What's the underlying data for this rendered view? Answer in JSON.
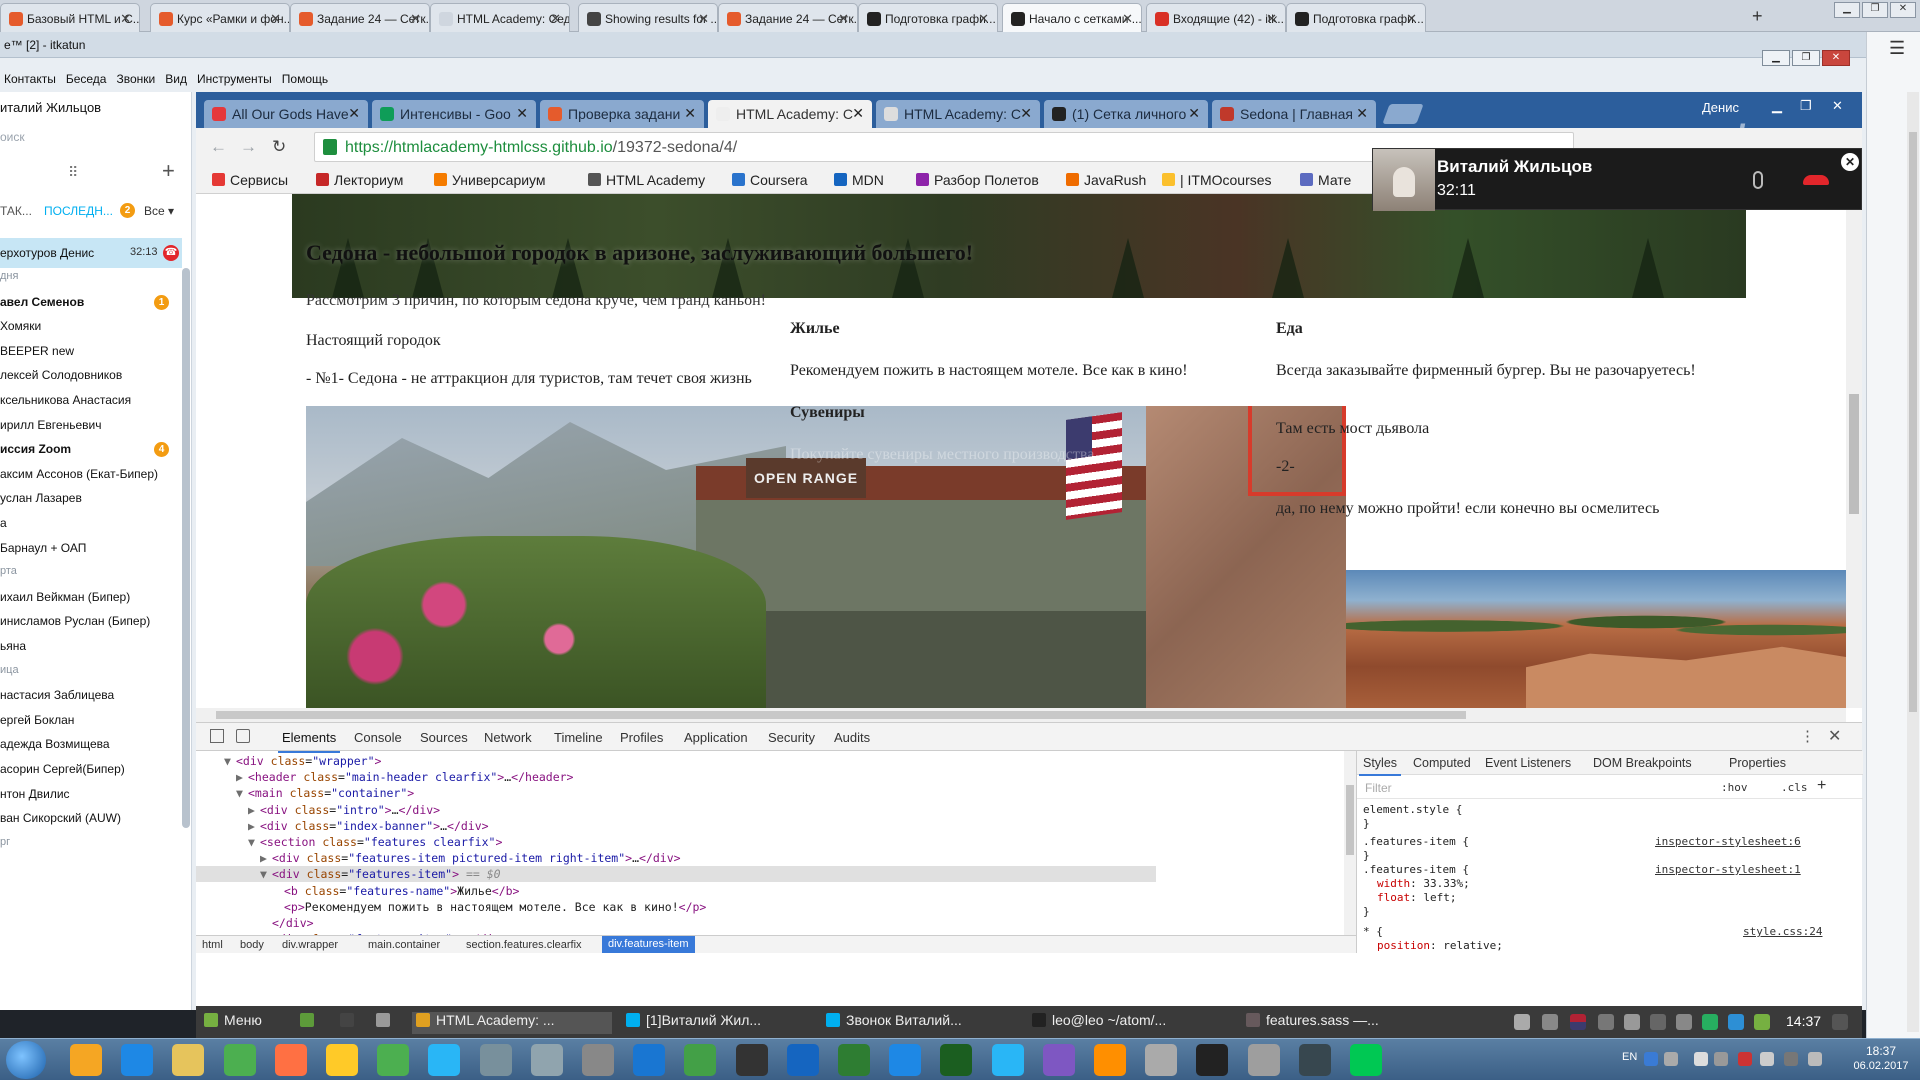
{
  "outer_tabs": [
    {
      "label": "Базовый HTML и С...",
      "color": "#e55b2c",
      "active": false
    },
    {
      "label": "Курс «Рамки и фон...",
      "color": "#e55b2c",
      "active": false
    },
    {
      "label": "Задание 24 — Сетк...",
      "color": "#e55b2c",
      "active": false
    },
    {
      "label": "HTML Academy: Седона",
      "color": "#cfd6df",
      "active": false
    },
    {
      "label": "Showing results for ...",
      "color": "#444444",
      "active": false
    },
    {
      "label": "Задание 24 — Сетк...",
      "color": "#e55b2c",
      "active": false
    },
    {
      "label": "Подготовка графи...",
      "color": "#222222",
      "active": false
    },
    {
      "label": "Начало с сетками ...",
      "color": "#222222",
      "active": true
    },
    {
      "label": "Входящие (42) - itk...",
      "color": "#d93025",
      "active": false
    },
    {
      "label": "Подготовка графи...",
      "color": "#222222",
      "active": false
    }
  ],
  "skype": {
    "window_title": "e™ [2] - itkatun",
    "menu": [
      "Контакты",
      "Беседа",
      "Звонки",
      "Вид",
      "Инструменты",
      "Помощь"
    ],
    "profile_name": "италий Жильцов",
    "search_placeholder": "оиск",
    "filter_contacts": "ТАК...",
    "filter_recent": "ПОСЛЕДН...",
    "filter_recent_badge": "2",
    "filter_all": "Все",
    "active_chat": {
      "name": "ерхотуров Денис",
      "time": "32:13"
    },
    "contacts": [
      {
        "name": "дня",
        "type": "section"
      },
      {
        "name": "авел Семенов",
        "type": "bold",
        "badge": "1"
      },
      {
        "name": "Хомяки",
        "type": "normal"
      },
      {
        "name": "BEEPER new",
        "type": "normal"
      },
      {
        "name": "лексей Солодовников",
        "type": "normal"
      },
      {
        "name": "ксельникова Анастасия",
        "type": "normal"
      },
      {
        "name": "ирилл Евгеньевич",
        "type": "normal"
      },
      {
        "name": "иссия Zoom",
        "type": "bold",
        "badge": "4"
      },
      {
        "name": "аксим Ассонов (Екат-Бипер)",
        "type": "normal"
      },
      {
        "name": "услан Лазарев",
        "type": "normal"
      },
      {
        "name": "a",
        "type": "normal"
      },
      {
        "name": "Барнаул + ОАП",
        "type": "normal"
      },
      {
        "name": "рта",
        "type": "section"
      },
      {
        "name": "ихаил Вейкман (Бипер)",
        "type": "normal"
      },
      {
        "name": "инисламов Руслан (Бипер)",
        "type": "normal"
      },
      {
        "name": "ьяна",
        "type": "normal"
      },
      {
        "name": "ица",
        "type": "section"
      },
      {
        "name": "настасия Заблицева",
        "type": "normal"
      },
      {
        "name": "ергей Боклан",
        "type": "normal"
      },
      {
        "name": "адежда Возмищева",
        "type": "normal"
      },
      {
        "name": "асорин Сергей(Бипер)",
        "type": "normal"
      },
      {
        "name": "нтон Двилис",
        "type": "normal"
      },
      {
        "name": "ван Сикорский (AUW)",
        "type": "normal"
      },
      {
        "name": "рг",
        "type": "section"
      }
    ]
  },
  "inner_browser": {
    "tabs": [
      {
        "label": "All Our Gods Have",
        "color": "#e5383b",
        "active": false
      },
      {
        "label": "Интенсивы - Goo",
        "color": "#0f9d58",
        "active": false
      },
      {
        "label": "Проверка задани",
        "color": "#e55b2c",
        "active": false
      },
      {
        "label": "HTML Academy: С",
        "color": "#eeeeee",
        "active": true
      },
      {
        "label": "HTML Academy: С",
        "color": "#dddddd",
        "active": false
      },
      {
        "label": "(1) Сетка личного",
        "color": "#222222",
        "active": false
      },
      {
        "label": "Sedona | Главная",
        "color": "#c0392b",
        "active": false
      }
    ],
    "user": "Денис",
    "url_host": "https://htmlacademy-htmlcss.github.io",
    "url_path": "/19372-sedona/4/",
    "bookmarks": [
      {
        "label": "Сервисы",
        "color": "#e53935"
      },
      {
        "label": "Лекториум",
        "color": "#c62828"
      },
      {
        "label": "Универсариум",
        "color": "#f57c00"
      },
      {
        "label": "HTML Academy",
        "color": "#555555"
      },
      {
        "label": "Coursera",
        "color": "#2a73cc"
      },
      {
        "label": "MDN",
        "color": "#1565c0"
      },
      {
        "label": "Разбор Полетов",
        "color": "#8e24aa"
      },
      {
        "label": "JavaRush",
        "color": "#ef6c00"
      },
      {
        "label": "| ITMOcourses",
        "color": "#fbc02d"
      },
      {
        "label": "Мате",
        "color": "#5c6bc0"
      }
    ]
  },
  "webpage": {
    "banner_title": "Седона - небольшой городок в аризоне, заслуживающий большего!",
    "intro": "Рассмотрим 3 причин, по которым седона круче, чем гранд каньон!",
    "col1_title": "Настоящий городок",
    "col1_text": "- №1- Седона - не аттракцион для туристов, там течет своя жизнь",
    "col2_title": "Жилье",
    "col2_text": "Рекомендуем пожить в настоящем мотеле. Все как в кино!",
    "col2_title2": "Сувениры",
    "col2_text2": "Покупайте сувениры местного производства",
    "col3_title": "Еда",
    "col3_text": "Всегда заказывайте фирменный бургер. Вы не разочаруетесь!",
    "col3_text2": "Там есть мост дьявола",
    "col3_text3": "-2-",
    "col3_text4": "да, по нему можно пройти! если конечно вы осмелитесь",
    "sign_text": "OPEN RANGE"
  },
  "call": {
    "name": "Виталий Жильцов",
    "time": "32:11"
  },
  "devtools": {
    "tabs": [
      "Elements",
      "Console",
      "Sources",
      "Network",
      "Timeline",
      "Profiles",
      "Application",
      "Security",
      "Audits"
    ],
    "styles_tabs": [
      "Styles",
      "Computed",
      "Event Listeners",
      "DOM Breakpoints",
      "Properties"
    ],
    "filter_placeholder": "Filter",
    "hov": ":hov",
    "cls": ".cls",
    "dom": [
      {
        "indent": 0,
        "arrow": "▼",
        "html": "<span class=\"tag\">&lt;div</span> <span class=\"attr\">class</span>=<span class=\"val\">\"wrapper\"</span><span class=\"tag\">&gt;</span>"
      },
      {
        "indent": 1,
        "arrow": "▶",
        "html": "<span class=\"tag\">&lt;header</span> <span class=\"attr\">class</span>=<span class=\"val\">\"main-header clearfix\"</span><span class=\"tag\">&gt;</span>…<span class=\"tag\">&lt;/header&gt;</span>"
      },
      {
        "indent": 1,
        "arrow": "▼",
        "html": "<span class=\"tag\">&lt;main</span> <span class=\"attr\">class</span>=<span class=\"val\">\"container\"</span><span class=\"tag\">&gt;</span>"
      },
      {
        "indent": 2,
        "arrow": "▶",
        "html": "<span class=\"tag\">&lt;div</span> <span class=\"attr\">class</span>=<span class=\"val\">\"intro\"</span><span class=\"tag\">&gt;</span>…<span class=\"tag\">&lt;/div&gt;</span>"
      },
      {
        "indent": 2,
        "arrow": "▶",
        "html": "<span class=\"tag\">&lt;div</span> <span class=\"attr\">class</span>=<span class=\"val\">\"index-banner\"</span><span class=\"tag\">&gt;</span>…<span class=\"tag\">&lt;/div&gt;</span>"
      },
      {
        "indent": 2,
        "arrow": "▼",
        "html": "<span class=\"tag\">&lt;section</span> <span class=\"attr\">class</span>=<span class=\"val\">\"features clearfix\"</span><span class=\"tag\">&gt;</span>"
      },
      {
        "indent": 3,
        "arrow": "▶",
        "html": "<span class=\"tag\">&lt;div</span> <span class=\"attr\">class</span>=<span class=\"val\">\"features-item pictured-item right-item\"</span><span class=\"tag\">&gt;</span>…<span class=\"tag\">&lt;/div&gt;</span>"
      },
      {
        "indent": 3,
        "arrow": "▼",
        "html": "<span class=\"tag\">&lt;div</span> <span class=\"attr\">class</span>=<span class=\"val\">\"features-item\"</span><span class=\"tag\">&gt;</span> <span class=\"eq0\">== $0</span>",
        "selected": true
      },
      {
        "indent": 4,
        "arrow": "",
        "html": "<span class=\"tag\">&lt;b</span> <span class=\"attr\">class</span>=<span class=\"val\">\"features-name\"</span><span class=\"tag\">&gt;</span><span class=\"txt\">Жилье</span><span class=\"tag\">&lt;/b&gt;</span>"
      },
      {
        "indent": 4,
        "arrow": "",
        "html": "<span class=\"tag\">&lt;p&gt;</span><span class=\"txt\">Рекомендуем пожить в настоящем мотеле. Все как в кино!</span><span class=\"tag\">&lt;/p&gt;</span>"
      },
      {
        "indent": 3,
        "arrow": "",
        "html": "<span class=\"tag\">&lt;/div&gt;</span>"
      },
      {
        "indent": 3,
        "arrow": "▶",
        "html": "<span class=\"tag\">&lt;div</span> <span class=\"attr\">class</span>=<span class=\"val\">\"features-item\"</span><span class=\"tag\">&gt;</span>…<span class=\"tag\">&lt;/div&gt;</span>"
      },
      {
        "indent": 3,
        "arrow": "▶",
        "html": "<span class=\"tag\">&lt;div</span> <span class=\"attr\">class</span>=<span class=\"val\">\"features-item\"</span><span class=\"tag\">&gt;</span>…<span class=\"tag\">&lt;/div&gt;</span>"
      }
    ],
    "breadcrumbs": [
      "html",
      "body",
      "div.wrapper",
      "main.container",
      "section.features.clearfix",
      "div.features-item"
    ],
    "rules": {
      "element_style": "element.style {",
      "rule1_selector": ".features-item {",
      "rule1_source": "inspector-stylesheet:6",
      "rule2_selector": ".features-item {",
      "rule2_source": "inspector-stylesheet:1",
      "rule2_prop1": "width",
      "rule2_val1": "33.33%;",
      "rule2_prop2": "float",
      "rule2_val2": "left;",
      "rule3_selector": "* {",
      "rule3_source": "style.css:24",
      "rule3_prop1": "position",
      "rule3_val1": "relative;",
      "close_brace": "}"
    }
  },
  "vm_panel": {
    "items": [
      {
        "label": "Меню",
        "color": "#76b041"
      },
      {
        "label": "",
        "color": "#5d9b3a"
      },
      {
        "label": "",
        "color": "#444444"
      },
      {
        "label": "",
        "color": "#9a9a9a"
      },
      {
        "label": "HTML Academy: ...",
        "color": "#e0a020",
        "active": true
      },
      {
        "label": "[1]Виталий Жил...",
        "color": "#00aff0"
      },
      {
        "label": "Звонок Виталий...",
        "color": "#00aff0"
      },
      {
        "label": "leo@leo ~/atom/...",
        "color": "#222222"
      },
      {
        "label": "features.sass —...",
        "color": "#66595c"
      }
    ],
    "time": "14:37"
  },
  "taskbar": {
    "lang": "EN",
    "time": "18:37",
    "date": "06.02.2017"
  }
}
